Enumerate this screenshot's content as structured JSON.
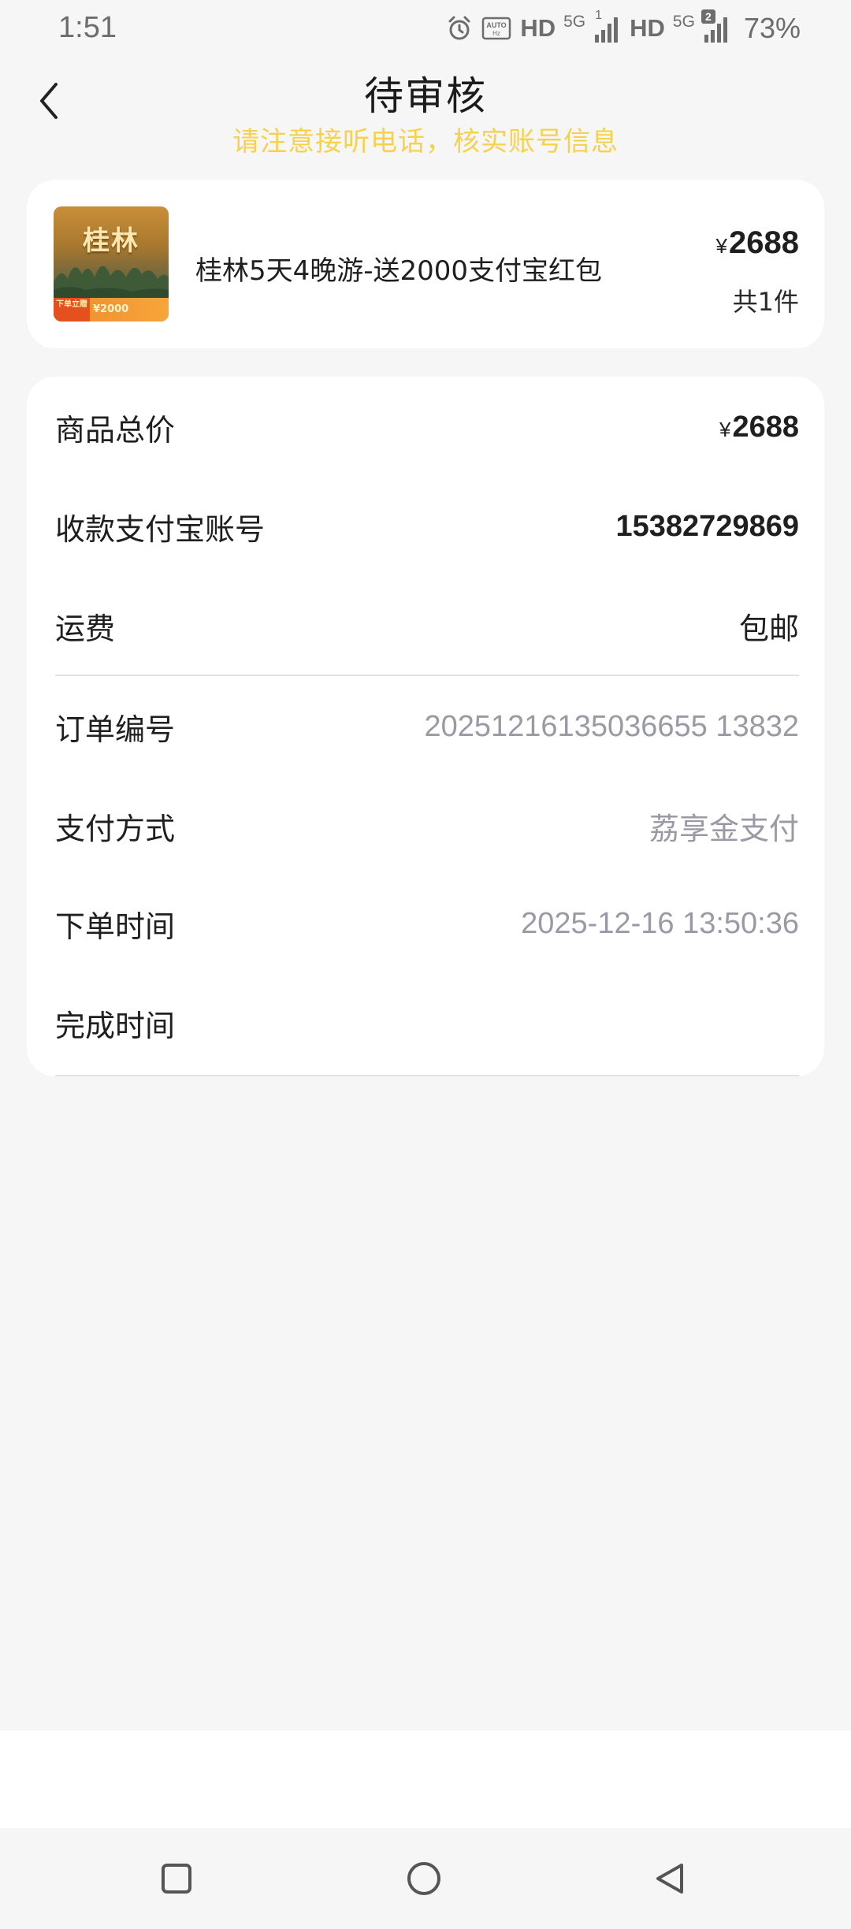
{
  "status_bar": {
    "time": "1:51",
    "hd1": "HD",
    "net1": "5G",
    "sim1": "1",
    "hd2": "HD",
    "net2": "5G",
    "sim2": "2",
    "battery": "73%",
    "icons": [
      "alarm-icon",
      "auto-hz-icon",
      "signal-icon",
      "signal-icon",
      "battery"
    ]
  },
  "header": {
    "title": "待审核",
    "subtitle": "请注意接听电话，核实账号信息",
    "subtitle_color": "#f6d24c",
    "back_icon": "chevron-left-icon"
  },
  "product": {
    "thumb_title": "桂林",
    "thumb_tag": "下单立赠",
    "thumb_amount": "¥2000",
    "name": "桂林5天4晚游-送2000支付宝红包",
    "currency": "¥",
    "price": "2688",
    "quantity": "共1件"
  },
  "details": {
    "total_label": "商品总价",
    "total_currency": "¥",
    "total_value": "2688",
    "alipay_label": "收款支付宝账号",
    "alipay_value": "15382729869",
    "shipping_label": "运费",
    "shipping_value": "包邮",
    "order_no_label": "订单编号",
    "order_no_value": "20251216135036655 13832",
    "pay_method_label": "支付方式",
    "pay_method_value": "荔享金支付",
    "order_time_label": "下单时间",
    "order_time_value": "2025-12-16 13:50:36",
    "finish_time_label": "完成时间",
    "finish_time_value": ""
  },
  "nav": {
    "recent_icon": "square-icon",
    "home_icon": "circle-icon",
    "back_icon": "triangle-back-icon"
  }
}
